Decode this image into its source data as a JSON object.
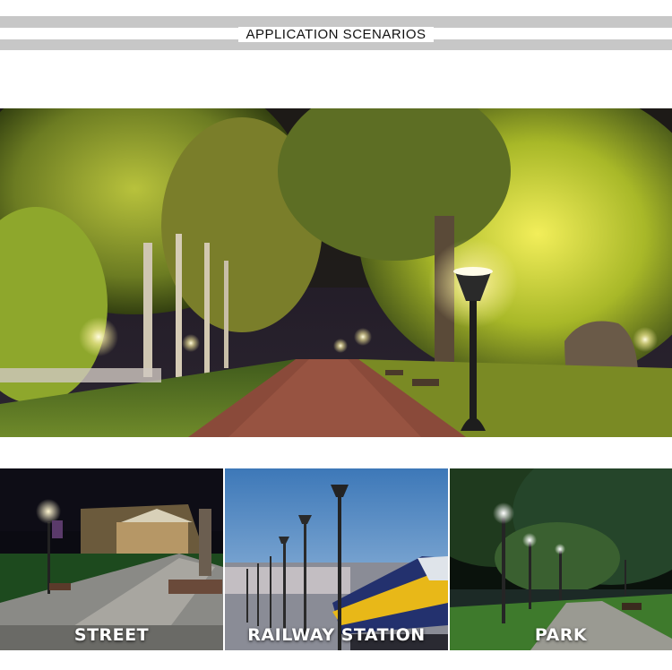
{
  "header": {
    "title": "APPLICATION SCENARIOS"
  },
  "scenes": {
    "hero": {
      "description": "Night park pathway with post-top lamp"
    },
    "tiles": [
      {
        "label": "STREET"
      },
      {
        "label": "RAILWAY STATION"
      },
      {
        "label": "PARK"
      }
    ]
  },
  "colors": {
    "header_band": "#c7c7c7",
    "caption_text": "#ffffff"
  }
}
